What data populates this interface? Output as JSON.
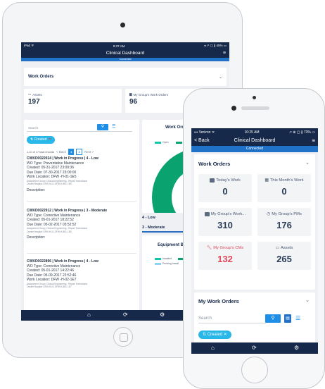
{
  "ipad": {
    "status_left": "iPad ᯤ",
    "status_time": "9:37 AM",
    "status_right": "◂ ↗ ▢ ∦ 45% ▭",
    "title": "Clinical Dashboard",
    "connection": "Connected",
    "section_title": "Work Orders",
    "cards": [
      {
        "label": "Assets",
        "value": "197"
      },
      {
        "label": "My Group's Work Orders",
        "value": "96"
      }
    ],
    "list": {
      "search_placeholder": "Search",
      "chip_label": "Created",
      "records_text": "1-10 of 17 total records",
      "pager": {
        "back": "< Back",
        "page1": "1",
        "page2": "2",
        "next": "Next >"
      },
      "description_label": "Description:",
      "items": [
        {
          "header": "CWKD0022024 | Work in Progress | 4 - Low",
          "type": "WO Type: Preventative Maintenance",
          "created": "Created: 05-31-2017 23:00:36",
          "due": "Due Date: 07-30-2017 23:00:00",
          "location": "Work Location: DFW -H-01-1E5",
          "assignment": "Assignment Group: Clinical Engineering - Repair Technicians",
          "owner": "Owner/Hospital: DFW-H-01 DFW-H-BEL 1E5"
        },
        {
          "header": "CWKD0022912 | Work in Progress | 3 - Moderate",
          "type": "WO Type: Corrective Maintenance",
          "created": "Created: 05-01-2017 18:22:52",
          "due": "Due Date: 05-02-2017 03:52:52",
          "location": "",
          "assignment": "Assignment Group: Clinical Engineering - Repair Technicians",
          "owner": "Owner/Hospital: DFW-H-01 DFW-H-BEL 1E5"
        },
        {
          "header": "CWKD0022896 | Work in Progress | 4 - Low",
          "type": "WO Type: Corrective Maintenance",
          "created": "Created: 05-01-2017 14:22:46",
          "due": "Due Date: 05-09-2017 22:52:46",
          "location": "Work Location: DFW -H-02-1E7",
          "assignment": "Assignment Group: Clinical Engineering - Repair Technicians",
          "owner": "Owner/Hospital: DFW-H-02 DFW-H-BEL 1E7"
        }
      ]
    },
    "chart": {
      "title": "Work Orders By",
      "legend": [
        "Open",
        "Work in"
      ],
      "colors": [
        "#12c6a7",
        "#0aa26f"
      ]
    },
    "priorities": [
      "4 - Low",
      "3 - Moderate"
    ],
    "equipment_chart": {
      "title": "Equipment By Insta",
      "legend": [
        "Installed",
        "In M",
        "Pending Install",
        "In St"
      ],
      "colors": [
        "#12c6a7",
        "#0aa26f",
        "#8fd3f0",
        "#9aa6b8"
      ]
    }
  },
  "iphone": {
    "status_left": "▪▪▪ Verizon ᯤ",
    "status_time": "10:25 AM",
    "status_right": "↗ ⊕ ▢ ∦ 73% ▭",
    "back_label": "< Back",
    "title": "Clinical Dashboard",
    "connection": "Connected",
    "section_title": "Work Orders",
    "tiles": [
      {
        "label": "Today's Work",
        "value": "0",
        "icon": "todays-work-icon"
      },
      {
        "label": "This Month's Work",
        "value": "0",
        "icon": "calendar-icon"
      },
      {
        "label": "My Group's Work...",
        "value": "310",
        "icon": "briefcase-icon"
      },
      {
        "label": "My Group's PMs",
        "value": "176",
        "icon": "clock-icon"
      },
      {
        "label": "My Group's CMs",
        "value": "132",
        "icon": "wrench-icon"
      },
      {
        "label": "Assets",
        "value": "265",
        "icon": "laptop-icon"
      }
    ],
    "my_work_orders_title": "My Work Orders",
    "search_placeholder": "Search",
    "chip_label": "Created ✕",
    "accent_red": "#e0475c"
  },
  "tabbar_icons": [
    "home-icon",
    "sync-icon",
    "gear-icon"
  ]
}
